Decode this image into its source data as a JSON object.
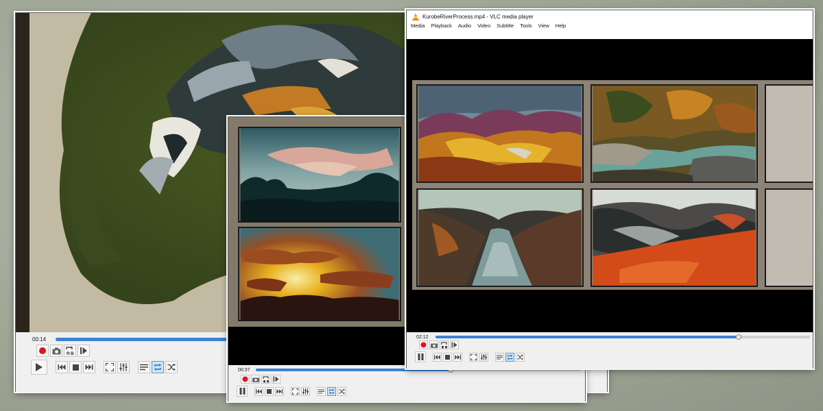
{
  "windows": {
    "back": {
      "time": "00:14",
      "progress": 0.47,
      "state": "play"
    },
    "middle": {
      "time": "00:37",
      "progress": 0.6,
      "state": "pause"
    },
    "front": {
      "title": "KurobeRiverProcess.mp4 - VLC media player",
      "menu": [
        "Media",
        "Playback",
        "Audio",
        "Video",
        "Subtitle",
        "Tools",
        "View",
        "Help"
      ],
      "time": "02:12",
      "progress": 0.81,
      "state": "pause"
    }
  },
  "abrepeat_label": "B",
  "colors": {
    "accent": "#3a82d2",
    "record": "#e2141c",
    "loop_active": "#cce4f7"
  },
  "icons": [
    "record-icon",
    "snapshot-icon",
    "ab-loop-icon",
    "frame-step-icon",
    "play-icon",
    "pause-icon",
    "previous-icon",
    "stop-icon",
    "next-icon",
    "fullscreen-icon",
    "extended-settings-icon",
    "playlist-icon",
    "loop-icon",
    "shuffle-icon",
    "vlc-cone-icon"
  ]
}
